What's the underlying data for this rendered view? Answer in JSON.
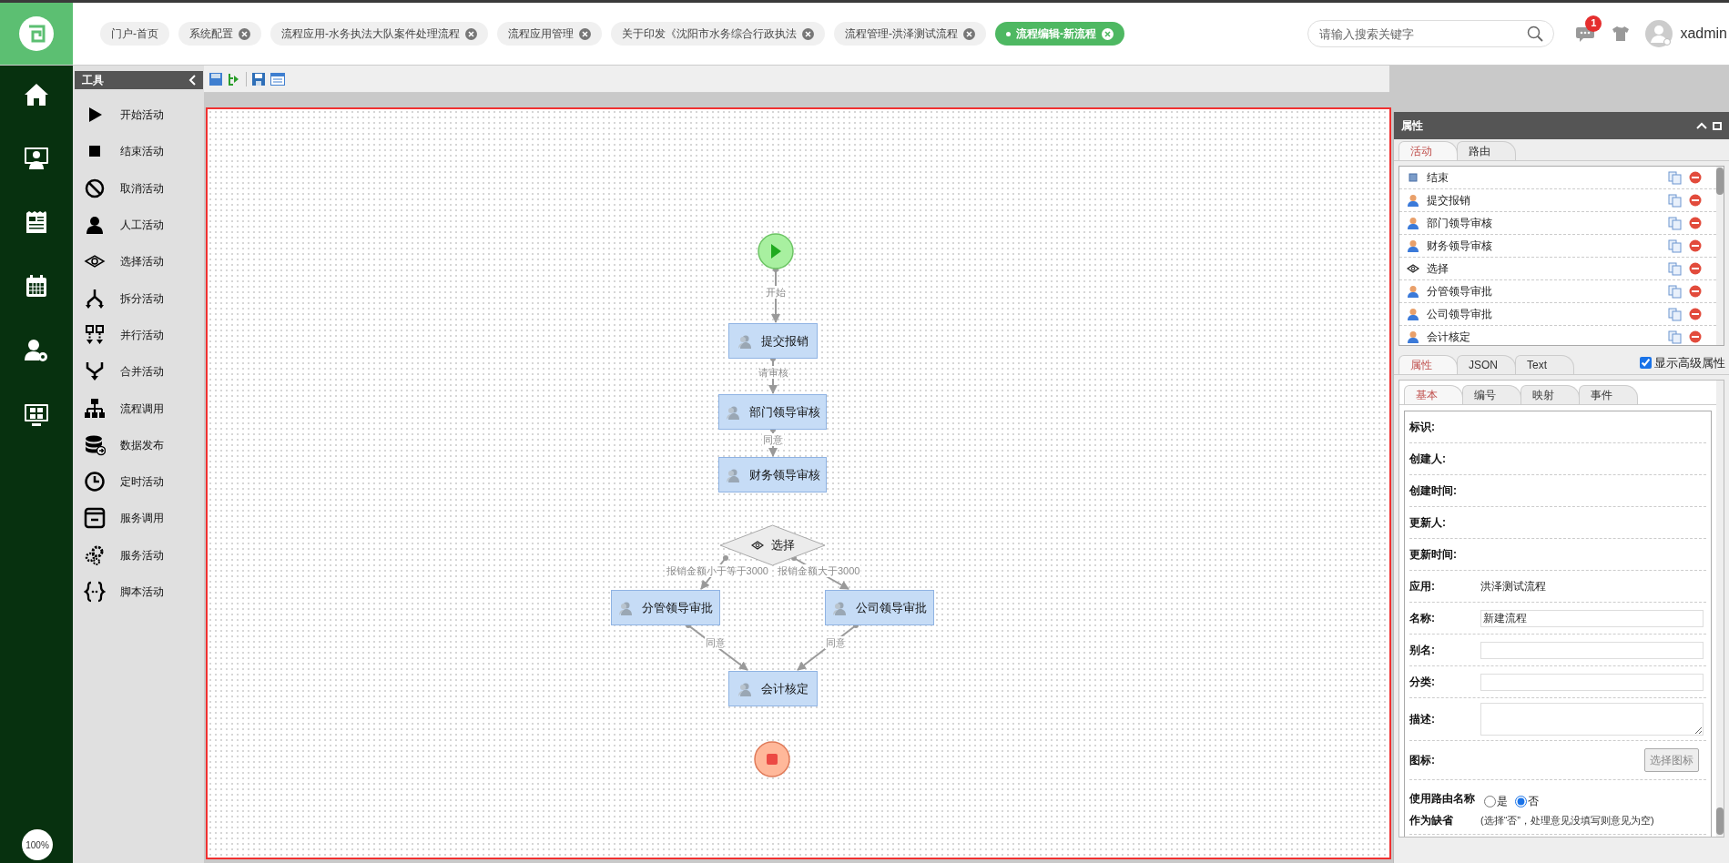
{
  "top_tabs": [
    {
      "label": "门户-首页",
      "closable": false,
      "selected": false
    },
    {
      "label": "系统配置",
      "closable": true,
      "selected": false
    },
    {
      "label": "流程应用-水务执法大队案件处理流程",
      "closable": true,
      "selected": false
    },
    {
      "label": "流程应用管理",
      "closable": true,
      "selected": false
    },
    {
      "label": "关于印发《沈阳市水务综合行政执法",
      "closable": true,
      "selected": false
    },
    {
      "label": "流程管理-洪泽测试流程",
      "closable": true,
      "selected": false
    },
    {
      "label": "流程编辑-新流程",
      "closable": true,
      "selected": true
    }
  ],
  "search": {
    "placeholder": "请输入搜索关键字"
  },
  "notifications": {
    "count": "1"
  },
  "user": {
    "name": "xadmin"
  },
  "zoom_level": "100%",
  "tools": {
    "title": "工具",
    "items": [
      {
        "label": "开始活动",
        "kind": "start"
      },
      {
        "label": "结束活动",
        "kind": "end"
      },
      {
        "label": "取消活动",
        "kind": "cancel"
      },
      {
        "label": "人工活动",
        "kind": "manual"
      },
      {
        "label": "选择活动",
        "kind": "choice"
      },
      {
        "label": "拆分活动",
        "kind": "split"
      },
      {
        "label": "并行活动",
        "kind": "parallel"
      },
      {
        "label": "合并活动",
        "kind": "merge"
      },
      {
        "label": "流程调用",
        "kind": "embed"
      },
      {
        "label": "数据发布",
        "kind": "publish"
      },
      {
        "label": "定时活动",
        "kind": "timer"
      },
      {
        "label": "服务调用",
        "kind": "invoke"
      },
      {
        "label": "服务活动",
        "kind": "service"
      },
      {
        "label": "脚本活动",
        "kind": "script"
      }
    ]
  },
  "diagram": {
    "nodes": [
      {
        "kind": "start"
      },
      {
        "kind": "task",
        "label": "提交报销"
      },
      {
        "kind": "task",
        "label": "部门领导审核"
      },
      {
        "kind": "task",
        "label": "财务领导审核"
      },
      {
        "kind": "choice",
        "label": "选择"
      },
      {
        "kind": "task",
        "label": "分管领导审批"
      },
      {
        "kind": "task",
        "label": "公司领导审批"
      },
      {
        "kind": "task",
        "label": "会计核定"
      },
      {
        "kind": "end"
      }
    ],
    "edges": [
      {
        "label": "开始"
      },
      {
        "label": "请审核"
      },
      {
        "label": "同意"
      },
      {
        "label": "报销金额小于等于3000"
      },
      {
        "label": "报销金额大于3000"
      },
      {
        "label": "同意"
      },
      {
        "label": "同意"
      }
    ]
  },
  "properties_panel": {
    "title": "属性",
    "list_tabs": [
      {
        "label": "活动",
        "selected": true
      },
      {
        "label": "路由",
        "selected": false
      }
    ],
    "activities": [
      {
        "kind": "end",
        "label": "结束"
      },
      {
        "kind": "task",
        "label": "提交报销"
      },
      {
        "kind": "task",
        "label": "部门领导审核"
      },
      {
        "kind": "task",
        "label": "财务领导审核"
      },
      {
        "kind": "choice",
        "label": "选择"
      },
      {
        "kind": "task",
        "label": "分管领导审批"
      },
      {
        "kind": "task",
        "label": "公司领导审批"
      },
      {
        "kind": "task",
        "label": "会计核定"
      }
    ],
    "detail_tabs": [
      {
        "label": "属性",
        "selected": true
      },
      {
        "label": "JSON",
        "selected": false
      },
      {
        "label": "Text",
        "selected": false
      }
    ],
    "show_advanced": {
      "label": "显示高级属性",
      "checked": true
    },
    "sub_tabs": [
      {
        "label": "基本",
        "selected": true
      },
      {
        "label": "编号",
        "selected": false
      },
      {
        "label": "映射",
        "selected": false
      },
      {
        "label": "事件",
        "selected": false
      }
    ],
    "fields": [
      {
        "label": "标识:",
        "kind": "text"
      },
      {
        "label": "创建人:",
        "kind": "text"
      },
      {
        "label": "创建时间:",
        "kind": "text"
      },
      {
        "label": "更新人:",
        "kind": "text"
      },
      {
        "label": "更新时间:",
        "kind": "text"
      },
      {
        "label": "应用:",
        "kind": "text",
        "value": "洪泽测试流程"
      },
      {
        "label": "名称:",
        "kind": "input",
        "value": "新建流程"
      },
      {
        "label": "别名:",
        "kind": "input"
      },
      {
        "label": "分类:",
        "kind": "input"
      },
      {
        "label": "描述:",
        "kind": "textarea"
      },
      {
        "label": "图标:",
        "kind": "button",
        "button": "选择图标"
      },
      {
        "label": "使用路由名称作为缺省",
        "kind": "radio",
        "options": [
          {
            "label": "是",
            "selected": false
          },
          {
            "label": "否",
            "selected": true
          }
        ],
        "note": "(选择“否”，处理意见没填写则意见为空)"
      }
    ]
  }
}
